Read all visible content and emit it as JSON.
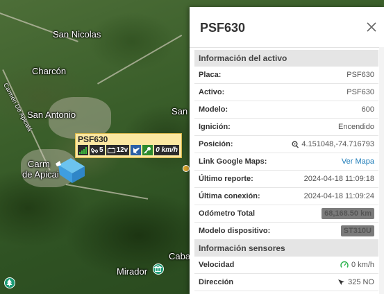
{
  "map": {
    "labels": {
      "san_nicolas": "San Nicolas",
      "charcon": "Charcón",
      "san_antonio": "San Antonio",
      "san_partial": "San",
      "carmen_line1": "Carm",
      "carmen_line2": "de Apicai",
      "road_carmen": "Carmen De Apicalá",
      "cabal_partial": "Caba",
      "mirador": "Mirador"
    },
    "vehicle": {
      "name": "PSF630",
      "signal_icon": "signal-bars-icon",
      "satellites": "5",
      "battery": "12v",
      "speed": "0 km/h"
    }
  },
  "panel": {
    "title": "PSF630",
    "close_icon": "close-icon",
    "sections": {
      "asset": {
        "title": "Información del activo",
        "rows": {
          "placa": {
            "label": "Placa:",
            "value": "PSF630"
          },
          "activo": {
            "label": "Activo:",
            "value": "PSF630"
          },
          "modelo": {
            "label": "Modelo:",
            "value": "600"
          },
          "ignicion": {
            "label": "Ignición:",
            "value": "Encendido"
          },
          "posicion": {
            "label": "Posición:",
            "value": "4.151048,-74.716793"
          },
          "gmaps": {
            "label": "Link Google Maps:",
            "value": "Ver Mapa"
          },
          "ultimo_reporte": {
            "label": "Último reporte:",
            "value": "2024-04-18 11:09:18"
          },
          "ultima_conexion": {
            "label": "Última conexión:",
            "value": "2024-04-18 11:09:24"
          },
          "odometro": {
            "label": "Odómetro Total",
            "value": "68,168.50 km"
          },
          "modelo_dispositivo": {
            "label": "Modelo dispositivo:",
            "value": "ST310U"
          }
        }
      },
      "sensors": {
        "title": "Información sensores",
        "rows": {
          "velocidad": {
            "label": "Velocidad",
            "value": "0 km/h"
          },
          "direccion": {
            "label": "Dirección",
            "value": "325 NO"
          }
        }
      }
    }
  }
}
